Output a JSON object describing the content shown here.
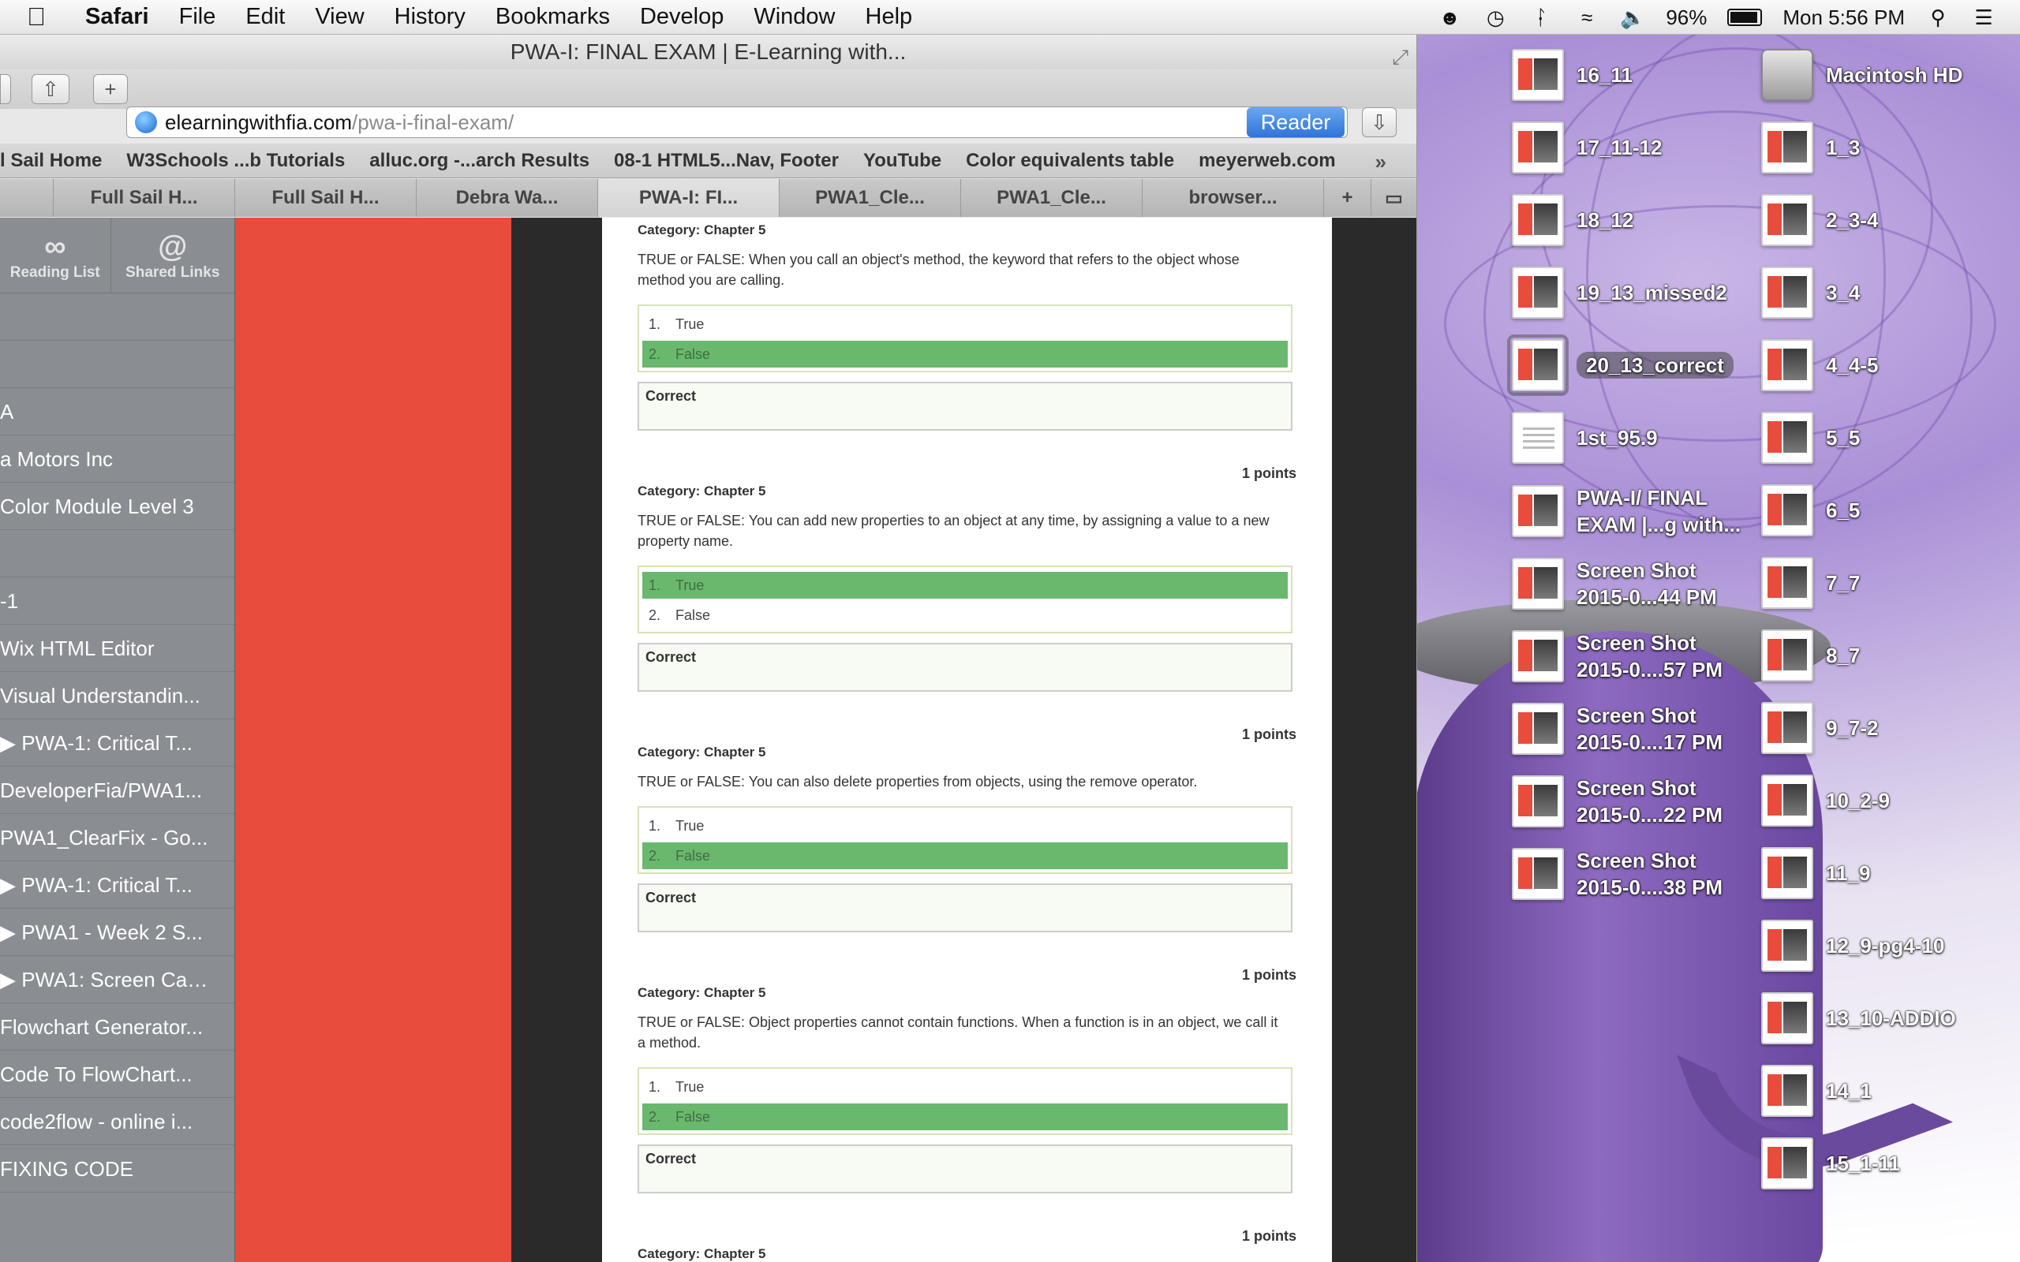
{
  "menubar": {
    "app": "Safari",
    "items": [
      "File",
      "Edit",
      "View",
      "History",
      "Bookmarks",
      "Develop",
      "Window",
      "Help"
    ],
    "battery": "96%",
    "clock": "Mon 5:56 PM"
  },
  "window": {
    "title": "PWA-I: FINAL EXAM | E-Learning with...",
    "url_host": "elearningwithfia.com",
    "url_path": "/pwa-i-final-exam/",
    "reader_label": "Reader"
  },
  "bookmarks": [
    "l Sail Home",
    "W3Schools ...b Tutorials",
    "alluc.org -...arch Results",
    "08-1 HTML5...Nav, Footer",
    "YouTube",
    "Color equivalents table",
    "meyerweb.com"
  ],
  "tabs": [
    {
      "label": "Full Sail H...",
      "active": false
    },
    {
      "label": "Full Sail H...",
      "active": false
    },
    {
      "label": "Debra Wa...",
      "active": false
    },
    {
      "label": "PWA-I: FI...",
      "active": true
    },
    {
      "label": "PWA1_Cle...",
      "active": false
    },
    {
      "label": "PWA1_Cle...",
      "active": false
    },
    {
      "label": "browser...",
      "active": false
    }
  ],
  "sidebar": {
    "reading_list": "Reading List",
    "shared_links": "Shared Links",
    "items": [
      "",
      "",
      "A",
      "a Motors Inc",
      "Color Module Level 3",
      "",
      "-1",
      "Wix HTML Editor",
      "Visual Understandin...",
      "▶ PWA-1: Critical T...",
      "DeveloperFia/PWA1...",
      "PWA1_ClearFix - Go...",
      "▶ PWA-1: Critical T...",
      "▶ PWA1 - Week 2 S...",
      "▶ PWA1: Screen Cas...",
      "Flowchart Generator...",
      "Code To FlowChart...",
      "code2flow - online i...",
      "FIXING CODE"
    ]
  },
  "questions": [
    {
      "category": "Category: Chapter 5",
      "text": "TRUE or FALSE:  When you call an object's method, the keyword that refers to the object whose method you are calling.",
      "answers": [
        {
          "n": "1.",
          "label": "True"
        },
        {
          "n": "2.",
          "label": "False"
        }
      ],
      "selected": 1,
      "result": "Correct",
      "points": "1 points"
    },
    {
      "category": "Category: Chapter 5",
      "text": "TRUE or FALSE:  You can add new properties to an object at any time, by assigning a value to a new property name.",
      "answers": [
        {
          "n": "1.",
          "label": "True"
        },
        {
          "n": "2.",
          "label": "False"
        }
      ],
      "selected": 0,
      "result": "Correct",
      "points": "1 points"
    },
    {
      "category": "Category: Chapter 5",
      "text": "TRUE or FALSE:  You can also delete properties from objects, using the remove operator.",
      "answers": [
        {
          "n": "1.",
          "label": "True"
        },
        {
          "n": "2.",
          "label": "False"
        }
      ],
      "selected": 1,
      "result": "Correct",
      "points": "1 points"
    },
    {
      "category": "Category: Chapter 5",
      "text": "TRUE or FALSE:  Object properties cannot contain functions. When a function is in an object, we call it a method.",
      "answers": [
        {
          "n": "1.",
          "label": "True"
        },
        {
          "n": "2.",
          "label": "False"
        }
      ],
      "selected": 1,
      "result": "Correct",
      "points": "1 points"
    },
    {
      "category": "Category: Chapter 5"
    }
  ],
  "desktop": {
    "col1": [
      {
        "label": "16_11",
        "type": "shot"
      },
      {
        "label": "17_11-12",
        "type": "shot"
      },
      {
        "label": "18_12",
        "type": "shot"
      },
      {
        "label": "19_13_missed2",
        "type": "shot"
      },
      {
        "label": "20_13_correct",
        "type": "shot",
        "selected": true
      },
      {
        "label": "1st_95.9",
        "type": "doc"
      },
      {
        "label": "PWA-I/ FINAL\nEXAM |...g with...",
        "type": "shot"
      },
      {
        "label": "Screen Shot\n2015-0...44 PM",
        "type": "shot"
      },
      {
        "label": "Screen Shot\n2015-0....57 PM",
        "type": "shot"
      },
      {
        "label": "Screen Shot\n2015-0....17 PM",
        "type": "shot"
      },
      {
        "label": "Screen Shot\n2015-0....22 PM",
        "type": "shot"
      },
      {
        "label": "Screen Shot\n2015-0....38 PM",
        "type": "shot"
      }
    ],
    "col2": [
      {
        "label": "Macintosh HD",
        "type": "hd"
      },
      {
        "label": "1_3",
        "type": "shot"
      },
      {
        "label": "2_3-4",
        "type": "shot"
      },
      {
        "label": "3_4",
        "type": "shot"
      },
      {
        "label": "4_4-5",
        "type": "shot"
      },
      {
        "label": "5_5",
        "type": "shot"
      },
      {
        "label": "6_5",
        "type": "shot"
      },
      {
        "label": "7_7",
        "type": "shot"
      },
      {
        "label": "8_7",
        "type": "shot"
      },
      {
        "label": "9_7-2",
        "type": "shot"
      },
      {
        "label": "10_2-9",
        "type": "shot"
      },
      {
        "label": "11_9",
        "type": "shot"
      },
      {
        "label": "12_9-pg4-10",
        "type": "shot"
      },
      {
        "label": "13_10-ADDIO",
        "type": "shot"
      },
      {
        "label": "14_1",
        "type": "shot"
      },
      {
        "label": "15_1-11",
        "type": "shot"
      }
    ]
  },
  "colors": {
    "accent": "#e74c3c",
    "selected_answer": "#6ab86e",
    "reader": "#2f74d8"
  }
}
